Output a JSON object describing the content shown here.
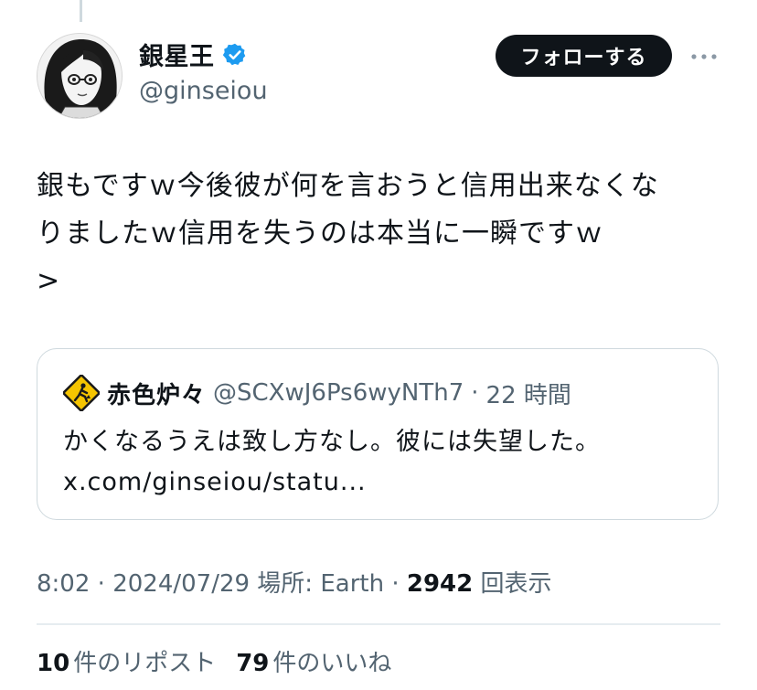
{
  "author": {
    "display_name": "銀星王",
    "handle": "@ginseiou",
    "verified_color": "#1d9bf0",
    "avatar_icon": "manga-portrait-avatar"
  },
  "actions": {
    "follow_label": "フォローする",
    "more_icon": "ellipsis-icon"
  },
  "tweet": {
    "lines": [
      "銀もですｗ今後彼が何を言おうと信用出来なくな",
      "りましたｗ信用を失うのは本当に一瞬ですｗ",
      ">"
    ]
  },
  "quote": {
    "avatar_icon": "construction-sign-avatar",
    "display_name": "赤色炉々",
    "handle": "@SCXwJ6Ps6wyNTh7",
    "separator": "·",
    "time": "22 時間",
    "lines": [
      "かくなるうえは致し方なし。彼には失望した。",
      "x.com/ginseiou/statu..."
    ]
  },
  "meta": {
    "time": "8:02",
    "sep1": " · ",
    "date": "2024/07/29",
    "location": " 場所: Earth",
    "sep2": " · ",
    "views_count": "2942",
    "views_label": " 回表示"
  },
  "stats": {
    "reposts_count": "10",
    "reposts_label": "件のリポスト",
    "likes_count": "79",
    "likes_label": "件のいいね"
  },
  "colors": {
    "text": "#0f1419",
    "muted": "#536471",
    "border": "#cfd9de",
    "follow_bg": "#0f1419"
  }
}
